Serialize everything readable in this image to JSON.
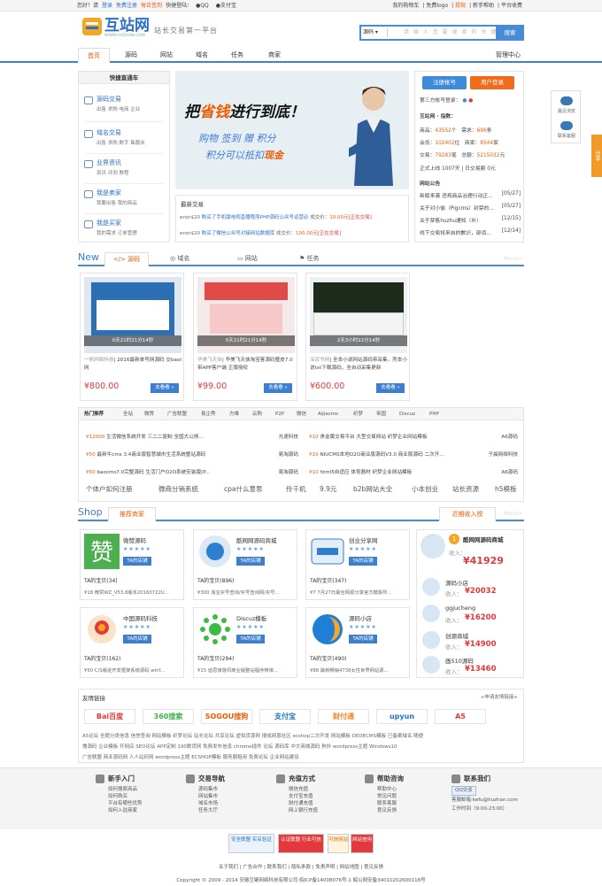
{
  "topbar": {
    "greeting": "您好！请",
    "login": "登录",
    "register": "免费注册",
    "checkin": "每日签到",
    "quick_login": "快捷登陆：",
    "qq": "QQ",
    "alipay": "支付宝",
    "right_items": [
      "我的购物车",
      "免费logo",
      "提现",
      "新手帮助",
      "平台收费"
    ]
  },
  "header": {
    "logo_text": "互站网",
    "logo_url": "WWW.HUZHAN.COM",
    "slogan": "站长交易第一平台",
    "search_select": "源码",
    "search_placeholder": "请 输 入 您 要 搜 索 的 关 键 词",
    "search_button": "搜索"
  },
  "nav": {
    "items": [
      "首页",
      "源码",
      "网站",
      "域名",
      "任务",
      "商家"
    ],
    "manage": "管理中心"
  },
  "quick": {
    "title": "快捷直通车",
    "groups": [
      {
        "title": "源码交易",
        "sub": "出售 求购 电商 企业"
      },
      {
        "title": "域名交易",
        "sub": "出售 求购 数字 集靓米"
      },
      {
        "title": "业界资讯",
        "sub": "资讯 评测 教程"
      },
      {
        "title": "我是卖家",
        "sub": "我要出售 我的商品"
      },
      {
        "title": "我是买家",
        "sub": "我的需求 订单管理"
      }
    ]
  },
  "banner": {
    "headline_pre": "把",
    "headline_hi": "省钱",
    "headline_post": "进行到底！",
    "line1": "购物 签到 赠 积分",
    "line2_pre": "积分可以抵扣",
    "line2_hi": "现金"
  },
  "deals": {
    "title": "最新交易",
    "rows": [
      {
        "user": "enor$20",
        "text": "购买了手机版电视直播程序PHP源码公众号运营必",
        "price_label": "成交价：",
        "price": "10.00元",
        "status": "[正在交易]"
      },
      {
        "user": "enor$20",
        "text": "购买了微信公众号对接网站数据库",
        "price_label": "成交价：",
        "price": "100.00元",
        "status": "[正在交易]"
      }
    ]
  },
  "login_box": {
    "register": "注册帐号",
    "login": "用户登录",
    "third_party": "第三方帐号登录：",
    "index_title": "互站网 · 指数：",
    "stats": [
      {
        "label": "商品：",
        "value": "43552",
        "unit": "个",
        "label2": "需求：",
        "value2": "696",
        "unit2": "条"
      },
      {
        "label": "会员：",
        "value": "102402",
        "unit": "位",
        "label2": "商家：",
        "value2": "8544",
        "unit2": "家"
      },
      {
        "label": "交易：",
        "value": "79283",
        "unit": "笔",
        "label2": "总额：",
        "value2": "5215032",
        "unit2": "元"
      }
    ],
    "online": "正式上线 1007天 | 日交易额 0元",
    "notice_title": "网站公告",
    "notices": [
      {
        "text": "新版来袭 违规商品治理行动正...",
        "date": "[05/27]"
      },
      {
        "text": "关于对小偷（Pigcms）封禁的...",
        "date": "[05/27]"
      },
      {
        "text": "关于禁售huzhu通知（补）",
        "date": "[12/15]"
      },
      {
        "text": "线下交易将来自的歉识，部佰...",
        "date": "[12/14]"
      }
    ]
  },
  "side": {
    "browse": "最近浏览",
    "service": "联系客服",
    "share": "分享"
  },
  "new_section": {
    "label": "New",
    "tabs": [
      "源码",
      "域名",
      "网站",
      "任务"
    ],
    "more": "More>"
  },
  "products": [
    {
      "time": "0天21时21分14秒",
      "seller": "一帆网络科技",
      "title": "| 2016最新单号网源码 交baol网",
      "price": "¥800.00",
      "buy": "去看看 »"
    },
    {
      "time": "0天21时21分14秒",
      "seller": "华美飞天侠",
      "title": "| 华美飞天侠淘宝客源码整皮7.0带APP客户端 正版授权",
      "price": "¥99.00",
      "buy": "去看看 »"
    },
    {
      "time": "2天3小时22分14秒",
      "seller": "深宏爷网",
      "title": "| 全本小说网站源码带采集，壳本小说txt下载源码，全自动采集更新",
      "price": "¥600.00",
      "buy": "去看看 »"
    }
  ],
  "hot": {
    "title": "热门推荐",
    "tags": [
      "全站",
      "微赞",
      "广告联盟",
      "易企秀",
      "方维",
      "云购",
      "P2P",
      "微信",
      "Aijiacms",
      "织梦",
      "帝国",
      "Discuz",
      "PHP"
    ],
    "left": [
      {
        "price": "¥12000",
        "text": "生活微信系统开发 三二二复制 全国大公排...",
        "seller": "光速科技"
      },
      {
        "price": "¥50",
        "text": "最新牛cms 3.4商业版智慧城市生活系统整站源码",
        "seller": "易淘源码"
      },
      {
        "price": "¥50",
        "text": "baocms7.0完整源码 生活门户O2O系统安装版[P...",
        "seller": "易淘源码"
      }
    ],
    "right": [
      {
        "price": "¥10",
        "text": "贵金属交易平台 大型交易网站 织梦企业网站模板",
        "seller": "A6源码"
      },
      {
        "price": "¥10",
        "text": "NIUCMS本地O2O商业版源码V3.0 商业版源码 二次开...",
        "seller": "子晨网络科技"
      },
      {
        "price": "¥10",
        "text": "html5自适应 体育器材 织梦企业网站模板",
        "seller": "A6源码"
      }
    ],
    "keywords": [
      "个体户如何注册",
      "微商分销系统",
      "cpa什么意思",
      "伶千机",
      "9.9元",
      "b2b网站大全",
      "小本创业",
      "站长资源",
      "h5模板"
    ]
  },
  "shop_section": {
    "label": "Shop",
    "tab": "推荐商家",
    "rank_tab": "近期收入榜",
    "more": "More>"
  },
  "shops": [
    {
      "name": "微赞源码",
      "stars": "★★★★★",
      "badge": "TA的店铺",
      "goods": "TA的宝贝(34)",
      "best": "¥18  微赞WZ_V53.8版本20160722U..."
    },
    {
      "name": "酷网网源码商城",
      "stars": "★★★★★",
      "badge": "TA的店铺",
      "goods": "TA的宝贝(896)",
      "best": "¥300  淘宝买号查询/买号查询网/买号..."
    },
    {
      "name": "创业分享网",
      "stars": "★★★★★",
      "badge": "TA的店铺",
      "goods": "TA的宝贝(347)",
      "best": "¥7  7月27日最全网源分享官方模板所..."
    },
    {
      "name": "中国源码科技",
      "stars": "★★★★★",
      "badge": "TA的店铺",
      "goods": "TA的宝贝(162)",
      "best": "¥50  C/S版进开发框架系统源码 winf..."
    },
    {
      "name": "Discuz模板",
      "stars": "★★★★★",
      "badge": "TA的店铺",
      "goods": "TA的宝贝(294)",
      "best": "¥15  迪思旅游风商业版整站程序带演..."
    },
    {
      "name": "源码小店",
      "stars": "★★★★★",
      "badge": "TA的店铺",
      "goods": "TA的宝贝(490)",
      "best": "¥88  最新畅销4738女性世界网站源..."
    }
  ],
  "rank": [
    {
      "no": "1",
      "name": "酷网网源码商城",
      "label": "收入：",
      "value": "¥41929"
    },
    {
      "name": "源码小店",
      "label": "收入：",
      "value": "¥20032"
    },
    {
      "name": "ggjucheng",
      "label": "收入：",
      "value": "¥16200"
    },
    {
      "name": "创源商城",
      "label": "收入：",
      "value": "¥14900"
    },
    {
      "name": "画510源码",
      "label": "收入：",
      "value": "¥13460"
    }
  ],
  "links": {
    "title": "友情链接",
    "apply": "+申请友情链接+",
    "logos": [
      "Bai百度",
      "360搜索",
      "SOGOU搜狗",
      "支付宝",
      "财付通",
      "upyun",
      "A5"
    ],
    "row1": "A5论坛 全题分类信息 信誉查询 网站模板 织梦论坛 站长论坛 共享论坛 虚拟货源网 搜成网恩社区 ecshop二次开发 网站模板 DEDECMS模板 已备案域名 随便",
    "row2": "撸源码 企业模板 开网店 SEO论坛 APP定制 190数货网 免费发布信息 chrome插件 论坛 源码库 中文商城源码 狗外 wordpress主题 Windows10",
    "row3": "广告联盟 商业源码网 人人站织网 wordpress主题 ECSHOP模板 服务器租用 免费论坛 企业网站建设"
  },
  "footer": {
    "cols": [
      {
        "title": "新手入门",
        "items": [
          "如何搜索商品",
          "如何购买",
          "平台有哪些优势",
          "如何入驻商家"
        ]
      },
      {
        "title": "交易导航",
        "items": [
          "源码集市",
          "网站集市",
          "域名市场",
          "任务大厅"
        ]
      },
      {
        "title": "充值方式",
        "items": [
          "微信充值",
          "支付宝充值",
          "财付通充值",
          "网上银行充值"
        ]
      },
      {
        "title": "帮助咨询",
        "items": [
          "帮助中心",
          "常见问题",
          "联系客服",
          "意见反馈"
        ]
      },
      {
        "title": "联系我们",
        "items": [
          "QQ交谈",
          "客服邮箱:kefu@huzhan.com",
          "工作时间（9:00-23:00）"
        ]
      }
    ]
  },
  "badges": [
    "安全联盟 实名验证",
    "认证联盟 行业可信",
    "可信网站",
    "网站信用"
  ],
  "footer_links": "关于我们 | 广告合作 | 联系我们 | 隐私条款 | 免责声明 | 网站地图 | 意见反馈",
  "copyright": "Copyright © 2009 - 2014 安徽互聚网络科技有限公司 皖ICP备14008076号-1 皖公网安备34010202600118号"
}
